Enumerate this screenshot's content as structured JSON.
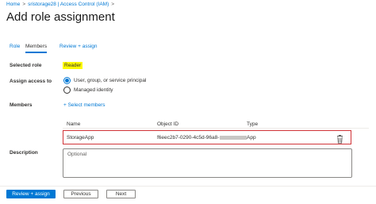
{
  "breadcrumb": {
    "items": [
      "Home",
      "sristorage28 | Access Control (IAM)"
    ],
    "separator": ">"
  },
  "page": {
    "title": "Add role assignment"
  },
  "tabs": [
    {
      "label": "Role",
      "active": false
    },
    {
      "label": "Members",
      "active": true
    },
    {
      "label": "Review + assign",
      "active": false
    }
  ],
  "form": {
    "selected_role_label": "Selected role",
    "selected_role_value": "Reader",
    "assign_access_label": "Assign access to",
    "assign_options": [
      {
        "label": "User, group, or service principal",
        "checked": true
      },
      {
        "label": "Managed identity",
        "checked": false
      }
    ],
    "members_label": "Members",
    "select_members_link": "+ Select members",
    "table": {
      "columns": [
        "Name",
        "Object ID",
        "Type"
      ],
      "rows": [
        {
          "name": "StorageApp",
          "object_id": "f6eec2b7-0290-4c5d-96a8-",
          "type": "App"
        }
      ]
    },
    "description_label": "Description",
    "description_placeholder": "Optional"
  },
  "footer": {
    "review_assign_label": "Review + assign",
    "previous_label": "Previous",
    "next_label": "Next"
  },
  "colors": {
    "accent": "#0078d4",
    "highlight": "#fffb00",
    "row_border": "#d13438"
  },
  "icons": {
    "delete": "trash-icon",
    "breadcrumb_separator": "chevron-right-icon"
  }
}
